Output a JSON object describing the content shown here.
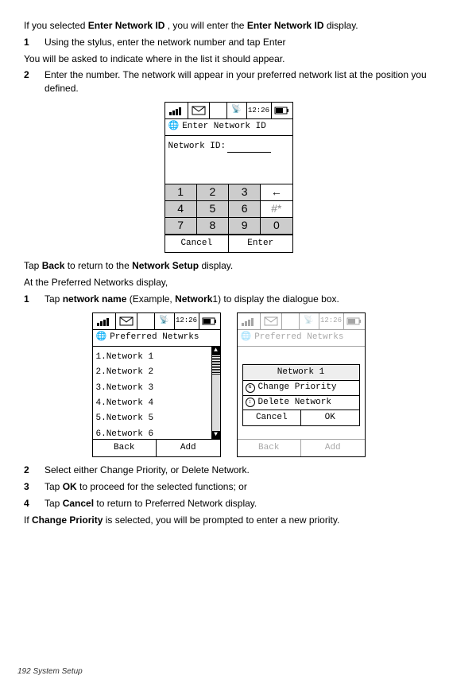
{
  "intro": {
    "line1_a": "If you selected ",
    "line1_b": "Enter Network ID",
    "line1_c": " , you will enter the ",
    "line1_d": "Enter Network ID",
    "line1_e": " display."
  },
  "steps_a": [
    {
      "n": "1",
      "t": "Using the stylus, enter the network number and tap Enter"
    }
  ],
  "line_asked": "You will be asked to indicate where in the list it should appear.",
  "steps_b": [
    {
      "n": "2",
      "t": "Enter the number. The network will appear in your preferred network list at the position you defined."
    }
  ],
  "phone1": {
    "time": "12:26",
    "title": "Enter Network ID",
    "label": "Network ID:",
    "keypad": [
      [
        "1",
        "2",
        "3",
        "←"
      ],
      [
        "4",
        "5",
        "6",
        "#*"
      ],
      [
        "7",
        "8",
        "9",
        "0"
      ]
    ],
    "sk_left": "Cancel",
    "sk_right": "Enter"
  },
  "after1": {
    "a": "Tap ",
    "b": "Back",
    "c": " to return to the ",
    "d": "Network Setup",
    "e": " display."
  },
  "atpref": "At the Preferred Networks display,",
  "steps_c": [
    {
      "n": "1",
      "t_a": "Tap ",
      "t_b": "network name",
      "t_c": " (Example, ",
      "t_d": "Network",
      "t_e": "1) to display the dialogue box."
    }
  ],
  "phone2": {
    "time": "12:26",
    "title": "Preferred Netwrks",
    "items": [
      "1.Network 1",
      "2.Network 2",
      "3.Network 3",
      "4.Network 4",
      "5.Network 5",
      "6.Network 6"
    ],
    "sk_left": "Back",
    "sk_right": "Add"
  },
  "phone3": {
    "time": "12:26",
    "title": "Preferred Netwrks",
    "dlg_title": "Network 1",
    "opt1": "Change Priority",
    "opt2": "Delete Network",
    "btn_cancel": "Cancel",
    "btn_ok": "OK",
    "sk_left": "Back",
    "sk_right": "Add"
  },
  "steps_d": [
    {
      "n": "2",
      "t": "Select either Change Priority, or Delete Network."
    },
    {
      "n": "3",
      "t_a": "Tap ",
      "t_b": "OK",
      "t_c": " to proceed for the selected functions; or"
    },
    {
      "n": "4",
      "t_a": "Tap ",
      "t_b": "Cancel",
      "t_c": " to return to Preferred Network display."
    }
  ],
  "final": {
    "a": "If ",
    "b": "Change Priority",
    "c": "  is selected, you will be prompted to enter a new priority."
  },
  "footer": "192   System Setup"
}
